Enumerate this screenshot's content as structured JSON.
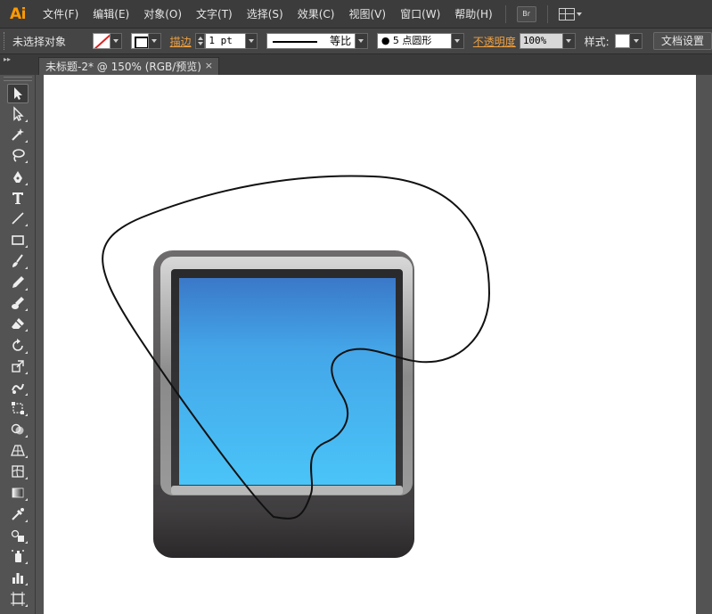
{
  "app": {
    "logo": "Ai"
  },
  "menu": {
    "items": [
      "文件(F)",
      "编辑(E)",
      "对象(O)",
      "文字(T)",
      "选择(S)",
      "效果(C)",
      "视图(V)",
      "窗口(W)",
      "帮助(H)"
    ],
    "bridge_label": "Br"
  },
  "control": {
    "selection_status": "未选择对象",
    "stroke_label": "描边",
    "stroke_weight": "1 pt",
    "profile_label": "等比",
    "brush_label": "● 5 点圆形",
    "opacity_label": "不透明度",
    "opacity_value": "100%",
    "style_label": "样式:",
    "doc_setup": "文档设置"
  },
  "tab": {
    "title": "未标题-2* @ 150% (RGB/预览)",
    "close": "×"
  },
  "tools": [
    "selection-tool-icon",
    "direct-selection-tool-icon",
    "magic-wand-tool-icon",
    "lasso-tool-icon",
    "pen-tool-icon",
    "type-tool-icon",
    "line-segment-tool-icon",
    "rectangle-tool-icon",
    "paintbrush-tool-icon",
    "pencil-tool-icon",
    "blob-brush-tool-icon",
    "eraser-tool-icon",
    "rotate-tool-icon",
    "scale-tool-icon",
    "warp-tool-icon",
    "free-transform-tool-icon",
    "shape-builder-tool-icon",
    "perspective-grid-tool-icon",
    "mesh-tool-icon",
    "gradient-tool-icon",
    "eyedropper-tool-icon",
    "blend-tool-icon",
    "symbol-sprayer-tool-icon",
    "column-graph-tool-icon",
    "artboard-tool-icon"
  ],
  "colors": {
    "accent": "#ff9a00",
    "screen_top": "#3a78c8",
    "screen_bottom": "#4ac4f8",
    "frame_dark": "#3a3839",
    "frame_light": "#6e6c6d"
  }
}
